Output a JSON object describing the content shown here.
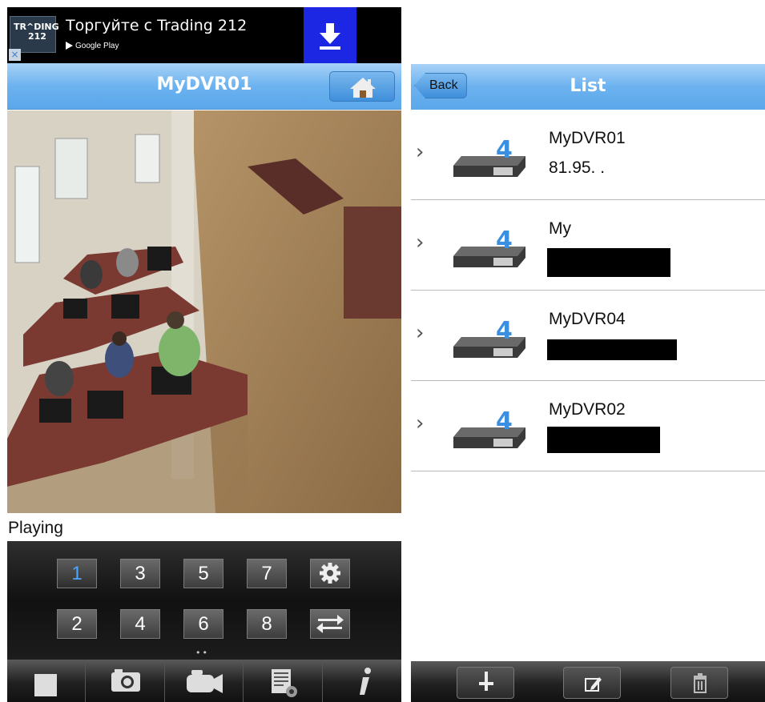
{
  "ad": {
    "logo_line1": "TR^DING",
    "logo_line2": "212",
    "close_glyph": "×",
    "title": "Торгуйте с Trading 212",
    "store": "Google Play",
    "download_icon": "download-icon"
  },
  "live_view": {
    "title": "MyDVR01",
    "home_icon": "home-icon",
    "status": "Playing",
    "channels": [
      "1",
      "3",
      "5",
      "7",
      "2",
      "4",
      "6",
      "8"
    ],
    "active_channel": "1",
    "settings_icon": "gear-icon",
    "swap_icon": "swap-icon",
    "page_dots": "••",
    "toolbar": [
      "stop-icon",
      "camera-icon",
      "video-camera-icon",
      "settings-list-icon",
      "info-icon"
    ]
  },
  "device_list": {
    "title": "List",
    "back_label": "Back",
    "items": [
      {
        "name": "MyDVR01",
        "address": "81.95.      ."
      },
      {
        "name": "My",
        "address": ""
      },
      {
        "name": "MyDVR04",
        "address": ""
      },
      {
        "name": "MyDVR02",
        "address": ""
      }
    ],
    "toolbar": [
      "plus-icon",
      "edit-icon",
      "trash-icon"
    ]
  },
  "colors": {
    "nav_blue": "#5aa7ea",
    "ad_download_blue": "#1b27e2",
    "active_channel": "#4da6ff"
  }
}
